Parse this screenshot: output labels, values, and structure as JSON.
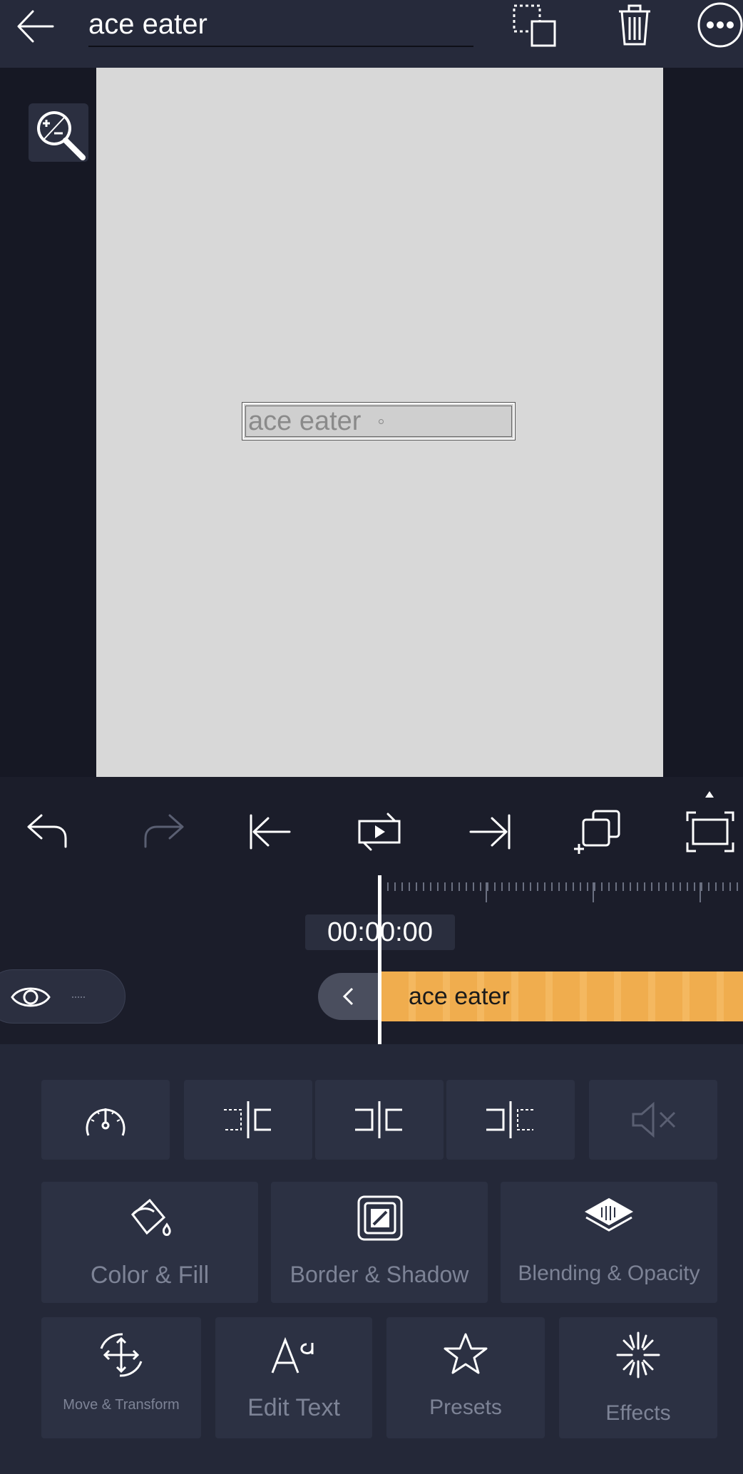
{
  "header": {
    "title": "ace eater",
    "icons": [
      "back-arrow-icon",
      "duplicate-icon",
      "trash-icon",
      "more-options-icon"
    ]
  },
  "canvas": {
    "text_layer": "ace eater",
    "zoom_icon": "zoom-icon"
  },
  "controls": {
    "icons": [
      "undo-icon",
      "redo-icon",
      "jump-start-icon",
      "play-loop-icon",
      "jump-end-icon",
      "copy-layer-icon",
      "fullscreen-icon"
    ]
  },
  "timeline": {
    "timecode": "00:00:00",
    "clip_label": "ace eater",
    "visibility_icon": "eye-icon"
  },
  "tools": {
    "row1": [
      "speed-icon",
      "split-left-icon",
      "split-center-icon",
      "split-right-icon",
      "mute-icon"
    ],
    "color_fill": "Color & Fill",
    "border_shadow": "Border & Shadow",
    "blending_opacity": "Blending & Opacity",
    "move_transform": "Move & Transform",
    "edit_text": "Edit Text",
    "presets": "Presets",
    "effects": "Effects"
  },
  "colors": {
    "background": "#1b1d2a",
    "header": "#262a3b",
    "artboard": "#d8d8d8",
    "clip": "#f0ad4e",
    "panel": "#242838",
    "tile": "#2c3143"
  }
}
